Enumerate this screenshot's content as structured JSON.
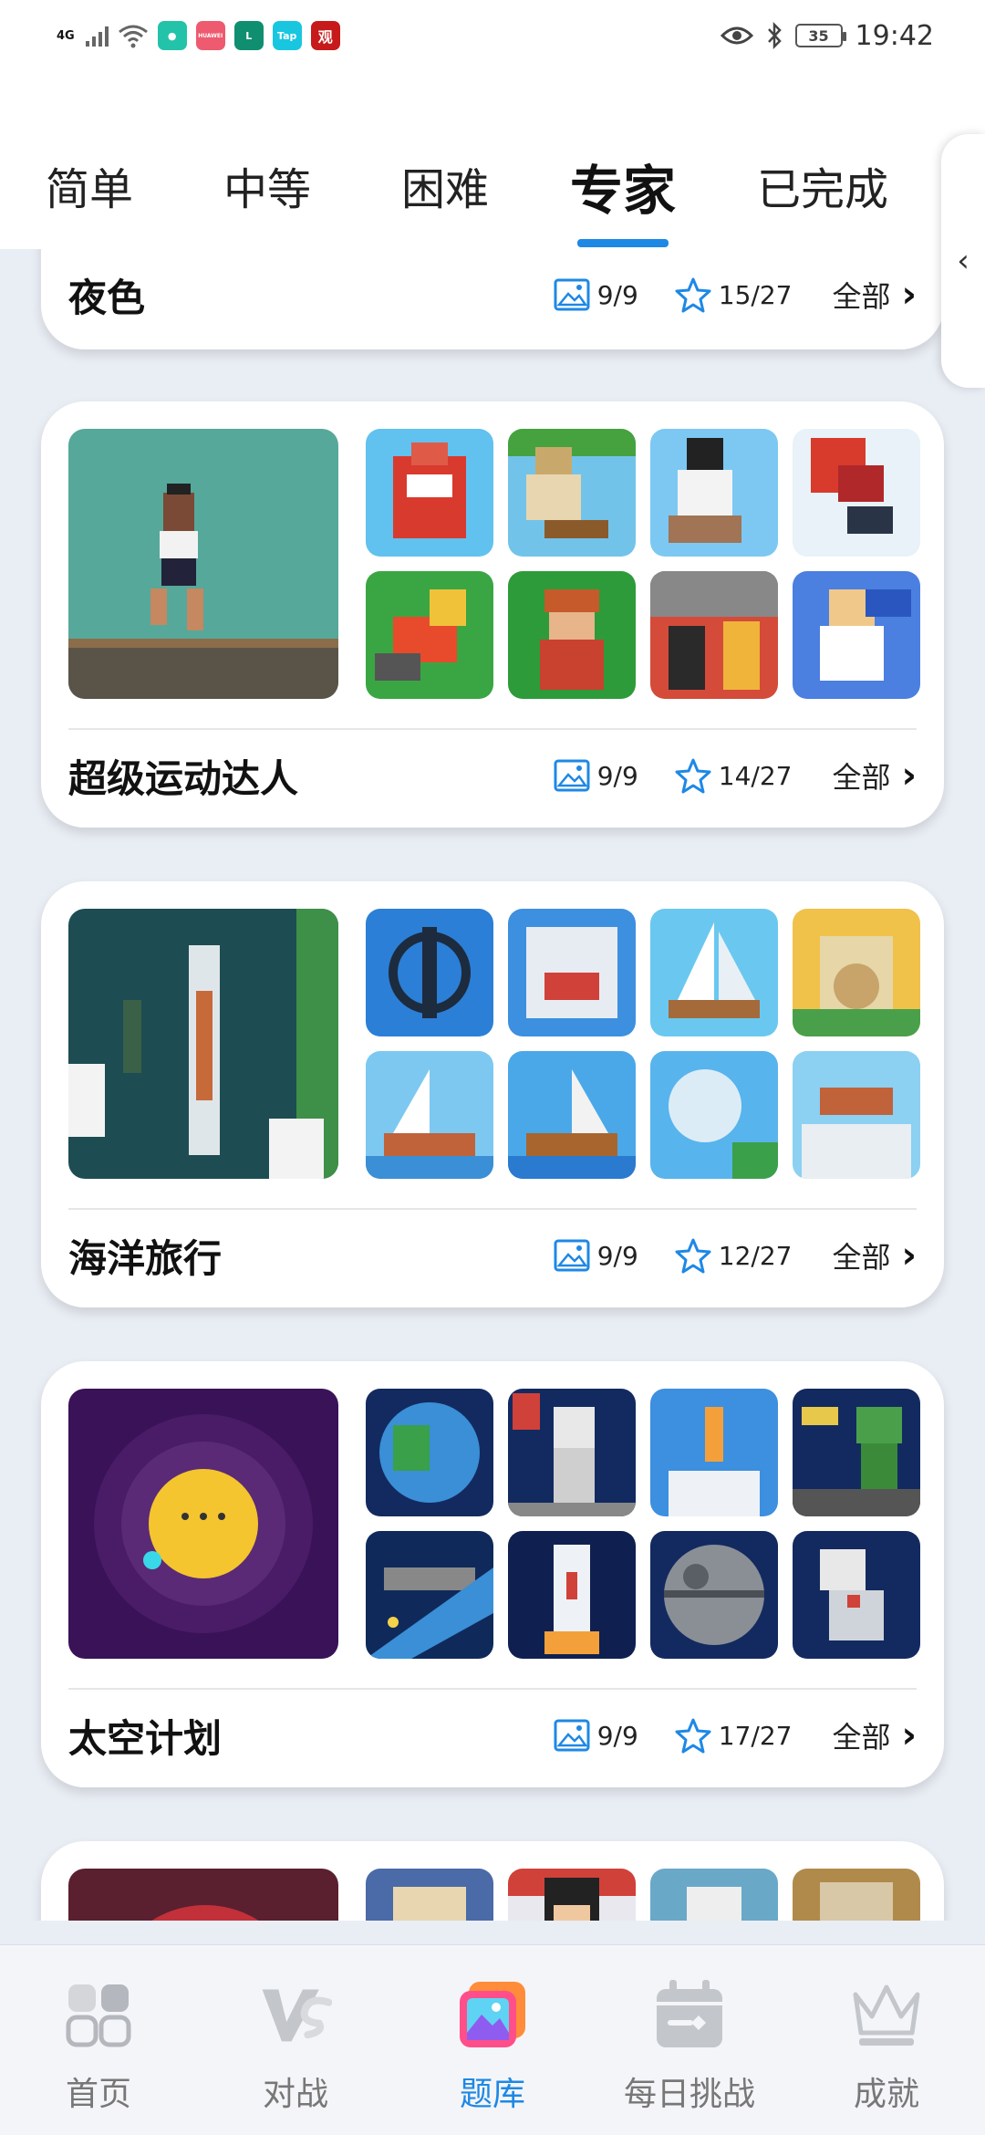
{
  "status_bar": {
    "network": "4G",
    "time": "19:42",
    "battery": "35",
    "app_icon_labels": [
      "HUAWEI",
      "Tap",
      "观"
    ]
  },
  "tabs": [
    {
      "label": "简单"
    },
    {
      "label": "中等"
    },
    {
      "label": "困难"
    },
    {
      "label": "专家"
    },
    {
      "label": "已完成"
    }
  ],
  "active_tab": "专家",
  "cards": [
    {
      "title": "夜色",
      "images": "9/9",
      "stars": "15/27",
      "all_label": "全部"
    },
    {
      "title": "超级运动达人",
      "images": "9/9",
      "stars": "14/27",
      "all_label": "全部"
    },
    {
      "title": "海洋旅行",
      "images": "9/9",
      "stars": "12/27",
      "all_label": "全部"
    },
    {
      "title": "太空计划",
      "images": "9/9",
      "stars": "17/27",
      "all_label": "全部"
    }
  ],
  "bottom_nav": [
    {
      "label": "首页",
      "icon": "home-grid-icon"
    },
    {
      "label": "对战",
      "icon": "vs-icon"
    },
    {
      "label": "题库",
      "icon": "puzzle-library-icon"
    },
    {
      "label": "每日挑战",
      "icon": "calendar-icon"
    },
    {
      "label": "成就",
      "icon": "crown-icon"
    }
  ],
  "colors": {
    "accent": "#1e88e5",
    "background": "#e9edf4"
  }
}
